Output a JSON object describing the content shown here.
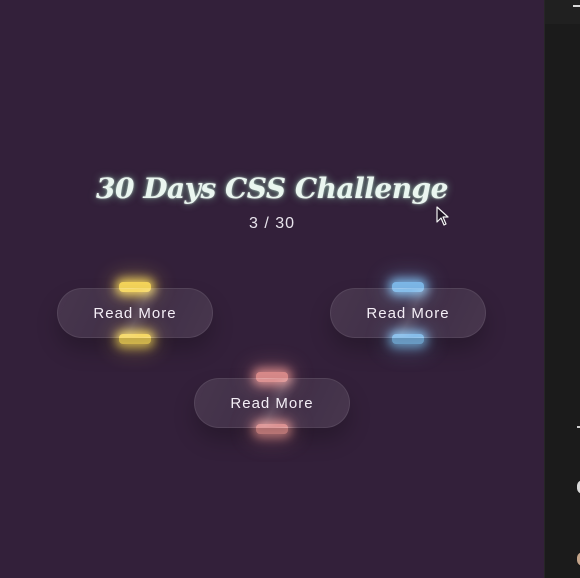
{
  "challenge": {
    "title": "30 Days CSS Challenge",
    "counter": "3 / 30"
  },
  "buttons": [
    {
      "label": "Read More",
      "glow_color": "#f5d55a"
    },
    {
      "label": "Read More",
      "glow_color": "#7db8e8"
    },
    {
      "label": "Read More",
      "glow_color": "#d98a8a"
    }
  ],
  "colors": {
    "background": "#33203a",
    "side_panel": "#1b1b1b"
  },
  "icons": {
    "cursor": "mouse-pointer-icon"
  }
}
